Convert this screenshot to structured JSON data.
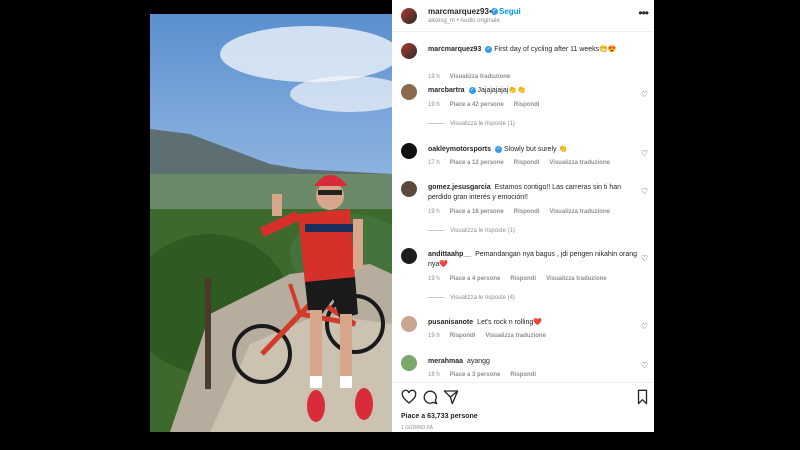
{
  "post": {
    "username": "marcmarquez93",
    "follow_label": "Segui",
    "audio": "alexisg_m • Audio originale",
    "caption": "First day of cycling after 11 weeks😁😍",
    "caption_time": "19 h",
    "caption_translate": "Visualizza traduzione"
  },
  "comments": [
    {
      "user": "marcbartra",
      "verified": true,
      "text": "Jajajajajaj👏👏",
      "time": "19 h",
      "likes": "Piace a 42 persone",
      "reply": "Rispondi",
      "translate": "",
      "replies": "Visualizza le risposte (1)",
      "avatar_color": "#8a6a4e"
    },
    {
      "user": "oakleymotorsports",
      "verified": true,
      "text": "Slowly but surely 👏",
      "time": "17 h",
      "likes": "Piace a 12 persone",
      "reply": "Rispondi",
      "translate": "Visualizza traduzione",
      "replies": "",
      "avatar_color": "#111111"
    },
    {
      "user": "gomez.jesusgarcia",
      "verified": false,
      "text": "Estamos contigo!! Las carreras sin ti han perdido gran interés y emoción!!",
      "time": "19 h",
      "likes": "Piace a 18 persone",
      "reply": "Rispondi",
      "translate": "Visualizza traduzione",
      "replies": "Visualizza le risposte (1)",
      "avatar_color": "#5a4a3c"
    },
    {
      "user": "andittaahp__",
      "verified": false,
      "text": "Pemandangan nya bagus , jdi pengen nikahin orang nya❤️",
      "time": "19 h",
      "likes": "Piace a 4 persone",
      "reply": "Rispondi",
      "translate": "Visualizza traduzione",
      "replies": "Visualizza le risposte (4)",
      "avatar_color": "#1d1d1d"
    },
    {
      "user": "pusanisanote",
      "verified": false,
      "text": "Let's rock n rolling❤️",
      "time": "19 h",
      "likes": "",
      "reply": "Rispondi",
      "translate": "Visualizza traduzione",
      "replies": "",
      "avatar_color": "#c9a78e"
    },
    {
      "user": "merahmaa",
      "verified": false,
      "text": "ayangg",
      "time": "18 h",
      "likes": "Piace a 3 persone",
      "reply": "Rispondi",
      "translate": "",
      "replies": "",
      "avatar_color": "#7aa86a"
    }
  ],
  "footer": {
    "likes": "Piace a 63,733 persone",
    "date": "1 GIORNO FA"
  },
  "icons": [
    "more-icon",
    "heart-icon",
    "comment-icon",
    "share-icon",
    "save-icon",
    "verified-icon"
  ],
  "colors": {
    "link": "#0095f6",
    "verified": "#3897f0",
    "muted": "#8e8e8e",
    "text": "#262626"
  }
}
